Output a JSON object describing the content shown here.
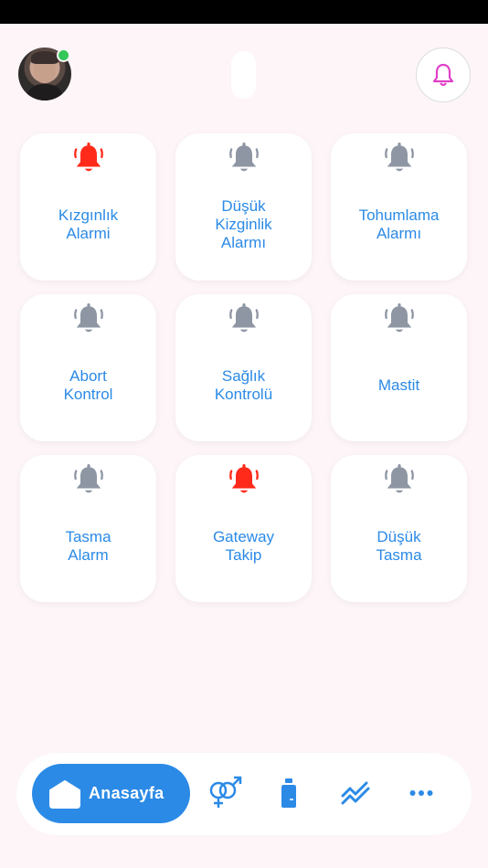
{
  "colors": {
    "accent": "#2b8ae6",
    "alarm_active": "#ff2a1a",
    "alarm_inactive": "#8e96a3",
    "notif_bell": "#e040c8",
    "online": "#34c759"
  },
  "header": {
    "avatar_icon": "user-avatar",
    "online_status_icon": "online-dot",
    "notification_icon": "bell-icon"
  },
  "alarms": [
    {
      "label": "Kızgınlık\nAlarmi",
      "active": true
    },
    {
      "label": "Düşük\nKizginlik\nAlarmı",
      "active": false
    },
    {
      "label": "Tohumlama\nAlarmı",
      "active": false
    },
    {
      "label": "Abort\nKontrol",
      "active": false
    },
    {
      "label": "Sağlık\nKontrolü",
      "active": false
    },
    {
      "label": "Mastit",
      "active": false
    },
    {
      "label": "Tasma\nAlarm",
      "active": false
    },
    {
      "label": "Gateway\nTakip",
      "active": true
    },
    {
      "label": "Düşük\nTasma",
      "active": false
    }
  ],
  "bottom_nav": {
    "home_label": "Anasayfa",
    "items": [
      {
        "icon": "home-icon"
      },
      {
        "icon": "gender-icon"
      },
      {
        "icon": "bottle-icon"
      },
      {
        "icon": "trend-icon"
      },
      {
        "icon": "more-icon"
      }
    ]
  }
}
